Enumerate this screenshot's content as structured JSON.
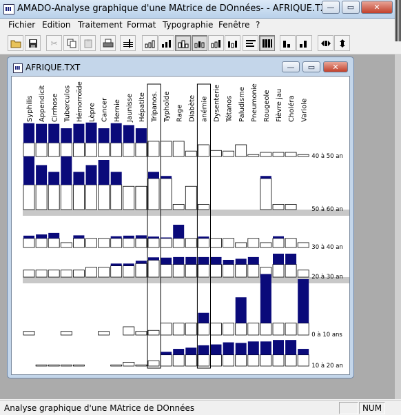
{
  "app": {
    "title": "AMADO-Analyse graphique d'une MAtrice de DOnnées- - AFRIQUE.TXT"
  },
  "window_buttons": {
    "minimize": "—",
    "maximize": "▭",
    "close": "✕"
  },
  "menu": [
    "Fichier",
    "Edition",
    "Traitement",
    "Format",
    "Typographie",
    "Fenêtre",
    "?"
  ],
  "toolbar": {
    "icons": [
      "open-folder-icon",
      "save-icon",
      "cut-icon",
      "copy-icon",
      "paste-icon",
      "print-icon",
      "sort-icon",
      "bar-chart-1-icon",
      "bar-chart-2-icon",
      "bar-chart-3-icon",
      "bar-chart-4-icon",
      "bar-chart-5-icon",
      "bar-chart-6-icon",
      "bar-chart-7-icon",
      "rows-icon",
      "grid-icon",
      "profile-a-icon",
      "profile-b-icon",
      "move-h-icon",
      "move-v-icon"
    ]
  },
  "document": {
    "title": "AFRIQUE.TXT"
  },
  "matrix": {
    "columns": [
      "Syphilis",
      "Appendicit",
      "Cirrhose",
      "Tuberculos",
      "Hémorroïde",
      "Lèpre",
      "Cancer",
      "Hernie",
      "Jaunisse",
      "Hépatite",
      "Tripanos.",
      "Typhoïde",
      "Rage",
      "Diabète",
      "anémie",
      "Dysenterie",
      "Tétanos",
      "Paludisme",
      "Pneumonie",
      "Rougeole",
      "Fièvre jau",
      "Choléra",
      "Variole"
    ],
    "highlighted_columns": [
      "Tripanos.",
      "anémie"
    ],
    "rows": [
      {
        "label": "40 à 50 an",
        "fill": [
          0.62,
          0.6,
          0.6,
          0.46,
          0.6,
          0.64,
          0.46,
          0.62,
          0.56,
          0.46,
          0.0,
          0.0,
          0.0,
          0.0,
          0.0,
          0.0,
          0.0,
          0.0,
          0.0,
          0.0,
          0.0,
          0.0,
          0.0
        ],
        "white": [
          0.43,
          0.43,
          0.43,
          0.43,
          0.43,
          0.43,
          0.43,
          0.43,
          0.43,
          0.43,
          0.48,
          0.48,
          0.48,
          0.17,
          0.37,
          0.19,
          0.17,
          0.37,
          0.06,
          0.13,
          0.13,
          0.13,
          0.06
        ]
      },
      {
        "label": "50 à 60 an",
        "fill": [
          0.55,
          0.38,
          0.25,
          0.55,
          0.25,
          0.38,
          0.48,
          0.25,
          0.0,
          0.0,
          0.13,
          0.05,
          0.0,
          0.0,
          0.0,
          0.0,
          0.0,
          0.0,
          0.0,
          0.05,
          0.0,
          0.0,
          0.0
        ],
        "white": [
          0.48,
          0.48,
          0.48,
          0.48,
          0.48,
          0.48,
          0.48,
          0.48,
          0.45,
          0.45,
          0.6,
          0.6,
          0.1,
          0.45,
          0.1,
          0.0,
          0.0,
          0.0,
          0.0,
          0.6,
          0.1,
          0.1,
          0.0
        ]
      },
      {
        "label": "30 à 40 an",
        "fill": [
          0.09,
          0.13,
          0.18,
          0.0,
          0.1,
          0.0,
          0.0,
          0.07,
          0.09,
          0.1,
          0.06,
          0.03,
          0.45,
          0.0,
          0.06,
          0.0,
          0.0,
          0.0,
          0.0,
          0.0,
          0.07,
          0.0,
          0.0
        ],
        "white": [
          0.3,
          0.3,
          0.3,
          0.16,
          0.3,
          0.3,
          0.3,
          0.3,
          0.3,
          0.3,
          0.3,
          0.3,
          0.3,
          0.3,
          0.3,
          0.3,
          0.3,
          0.16,
          0.3,
          0.16,
          0.3,
          0.3,
          0.16
        ]
      },
      {
        "label": "20 à 30 an",
        "fill": [
          0.0,
          0.0,
          0.0,
          0.0,
          0.0,
          0.0,
          0.0,
          0.08,
          0.08,
          0.1,
          0.1,
          0.24,
          0.26,
          0.26,
          0.26,
          0.26,
          0.16,
          0.2,
          0.26,
          0.0,
          0.38,
          0.38,
          0.0
        ],
        "white": [
          0.25,
          0.25,
          0.25,
          0.25,
          0.25,
          0.35,
          0.35,
          0.4,
          0.4,
          0.48,
          0.6,
          0.45,
          0.45,
          0.45,
          0.45,
          0.45,
          0.45,
          0.45,
          0.45,
          0.35,
          0.45,
          0.45,
          0.25
        ]
      },
      {
        "label": "0 à 10 ans",
        "fill": [
          0.0,
          0.0,
          0.0,
          0.0,
          0.0,
          0.0,
          0.0,
          0.0,
          0.0,
          0.0,
          0.0,
          0.0,
          0.0,
          0.0,
          0.2,
          0.0,
          0.0,
          0.5,
          0.0,
          0.95,
          0.0,
          0.0,
          0.85
        ],
        "white": [
          0.07,
          0.0,
          0.0,
          0.07,
          0.0,
          0.0,
          0.07,
          0.0,
          0.16,
          0.07,
          0.09,
          0.23,
          0.23,
          0.23,
          0.23,
          0.23,
          0.23,
          0.23,
          0.23,
          0.23,
          0.23,
          0.23,
          0.23
        ]
      },
      {
        "label": "10 à 20 an",
        "fill": [
          0.0,
          0.0,
          0.0,
          0.0,
          0.0,
          0.0,
          0.0,
          0.0,
          0.0,
          0.0,
          0.0,
          0.1,
          0.2,
          0.24,
          0.32,
          0.35,
          0.42,
          0.4,
          0.45,
          0.45,
          0.5,
          0.5,
          0.2
        ],
        "white": [
          0.0,
          0.04,
          0.04,
          0.04,
          0.04,
          0.0,
          0.0,
          0.04,
          0.13,
          0.04,
          0.18,
          0.38,
          0.38,
          0.38,
          0.38,
          0.38,
          0.38,
          0.38,
          0.38,
          0.38,
          0.38,
          0.38,
          0.38
        ]
      }
    ]
  },
  "statusbar": {
    "text": "Analyse graphique d'une MAtrice de DOnnées",
    "num": "NUM"
  }
}
